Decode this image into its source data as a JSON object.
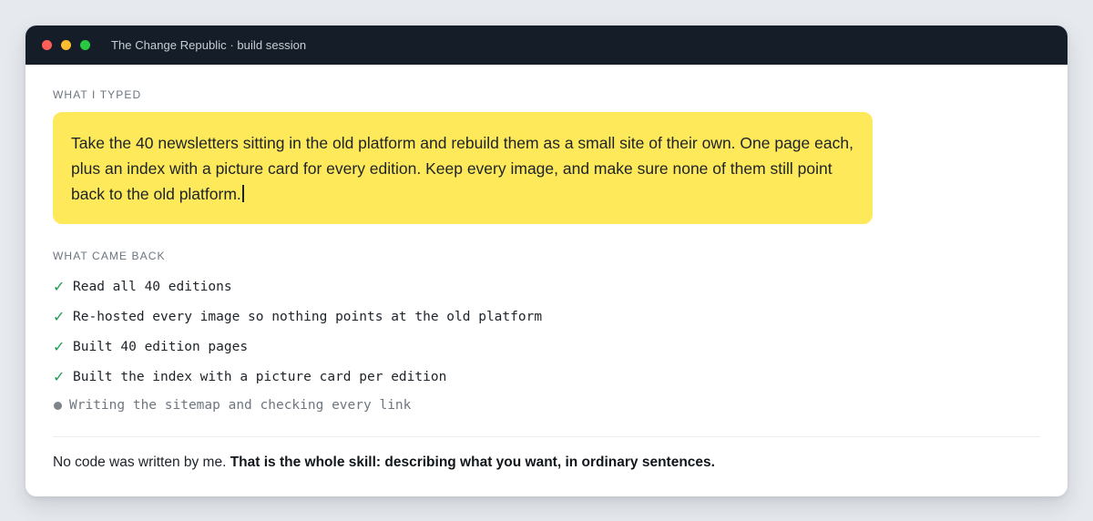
{
  "window": {
    "title": "The Change Republic · build session",
    "controls": [
      "close",
      "minimize",
      "maximize"
    ]
  },
  "typed": {
    "label": "WHAT I TYPED",
    "text": "Take the 40 newsletters sitting in the old platform and rebuild them as a small site of their own. One page each, plus an index with a picture card for every edition. Keep every image, and make sure none of them still point back to the old platform."
  },
  "results": {
    "label": "WHAT CAME BACK",
    "check_glyph": "✓",
    "steps": [
      {
        "text": "Read all 40 editions",
        "status": "done"
      },
      {
        "text": "Re-hosted every image so nothing points at the old platform",
        "status": "done"
      },
      {
        "text": "Built 40 edition pages",
        "status": "done"
      },
      {
        "text": "Built the index with a picture card per edition",
        "status": "done"
      },
      {
        "text": "Writing the sitemap and checking every link",
        "status": "in-progress"
      }
    ]
  },
  "footer": {
    "plain": "No code was written by me. ",
    "bold": "That is the whole skill: describing what you want, in ordinary sentences."
  },
  "colors": {
    "titlebar": "#151e28",
    "typed_box": "#fde95a",
    "check": "#1f9d55"
  }
}
